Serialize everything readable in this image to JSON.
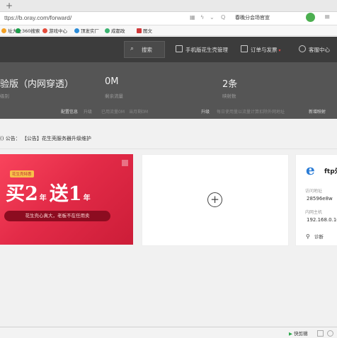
{
  "browser": {
    "newtab_glyph": "+",
    "url": "ttps://b.oray.com/forward/",
    "search_text": "春晚分会场官宣",
    "bookmarks": [
      {
        "label": "址大全",
        "color": "#f4a124"
      },
      {
        "label": "360搜索",
        "color": "#1aa04a"
      },
      {
        "label": "游戏中心",
        "color": "#e44b3a"
      },
      {
        "label": "顶发实厂",
        "color": "#2b8cd8"
      },
      {
        "label": "成都政",
        "color": "#3cb371"
      },
      {
        "label": "图文",
        "color": "#d0393a"
      }
    ]
  },
  "topnav": {
    "search_label": "搜索",
    "items": [
      "手机版花生壳管理",
      "订单与发票",
      "客服中心"
    ]
  },
  "stats": {
    "plan_value": "验版（内网穿透）",
    "plan_label": "级别",
    "traffic_value": "0M",
    "traffic_label": "剩余流量",
    "mappings_value": "2条",
    "mappings_label": "映射数",
    "links": [
      "配置信息",
      "升级",
      "已用流量0M",
      "当月剩0M",
      "升级",
      "每日使用量以流量计算扣除外网地址",
      "新增映射"
    ]
  },
  "notice": {
    "prefix": "()",
    "label": "公告：",
    "text": "【公告】花生壳服务器升级维护"
  },
  "promo": {
    "badge": "花生壳特惠",
    "headline_buy": "买",
    "buy_num": "2",
    "unit1": "年",
    "headline_get": "送",
    "get_num": "1",
    "unit2": "年",
    "slogan": "花生壳心真大，老板不在任用卖"
  },
  "add_card": {
    "icon": "+"
  },
  "ftp_card": {
    "logo": "e",
    "title": "ftp外",
    "access_label": "访问地址",
    "access_value": "28596e8w",
    "intranet_label": "内网主机",
    "intranet_value": "192.168.0.10",
    "diagnose_label": "诊断"
  },
  "statusbar": {
    "quick_label": "快剪辑"
  }
}
